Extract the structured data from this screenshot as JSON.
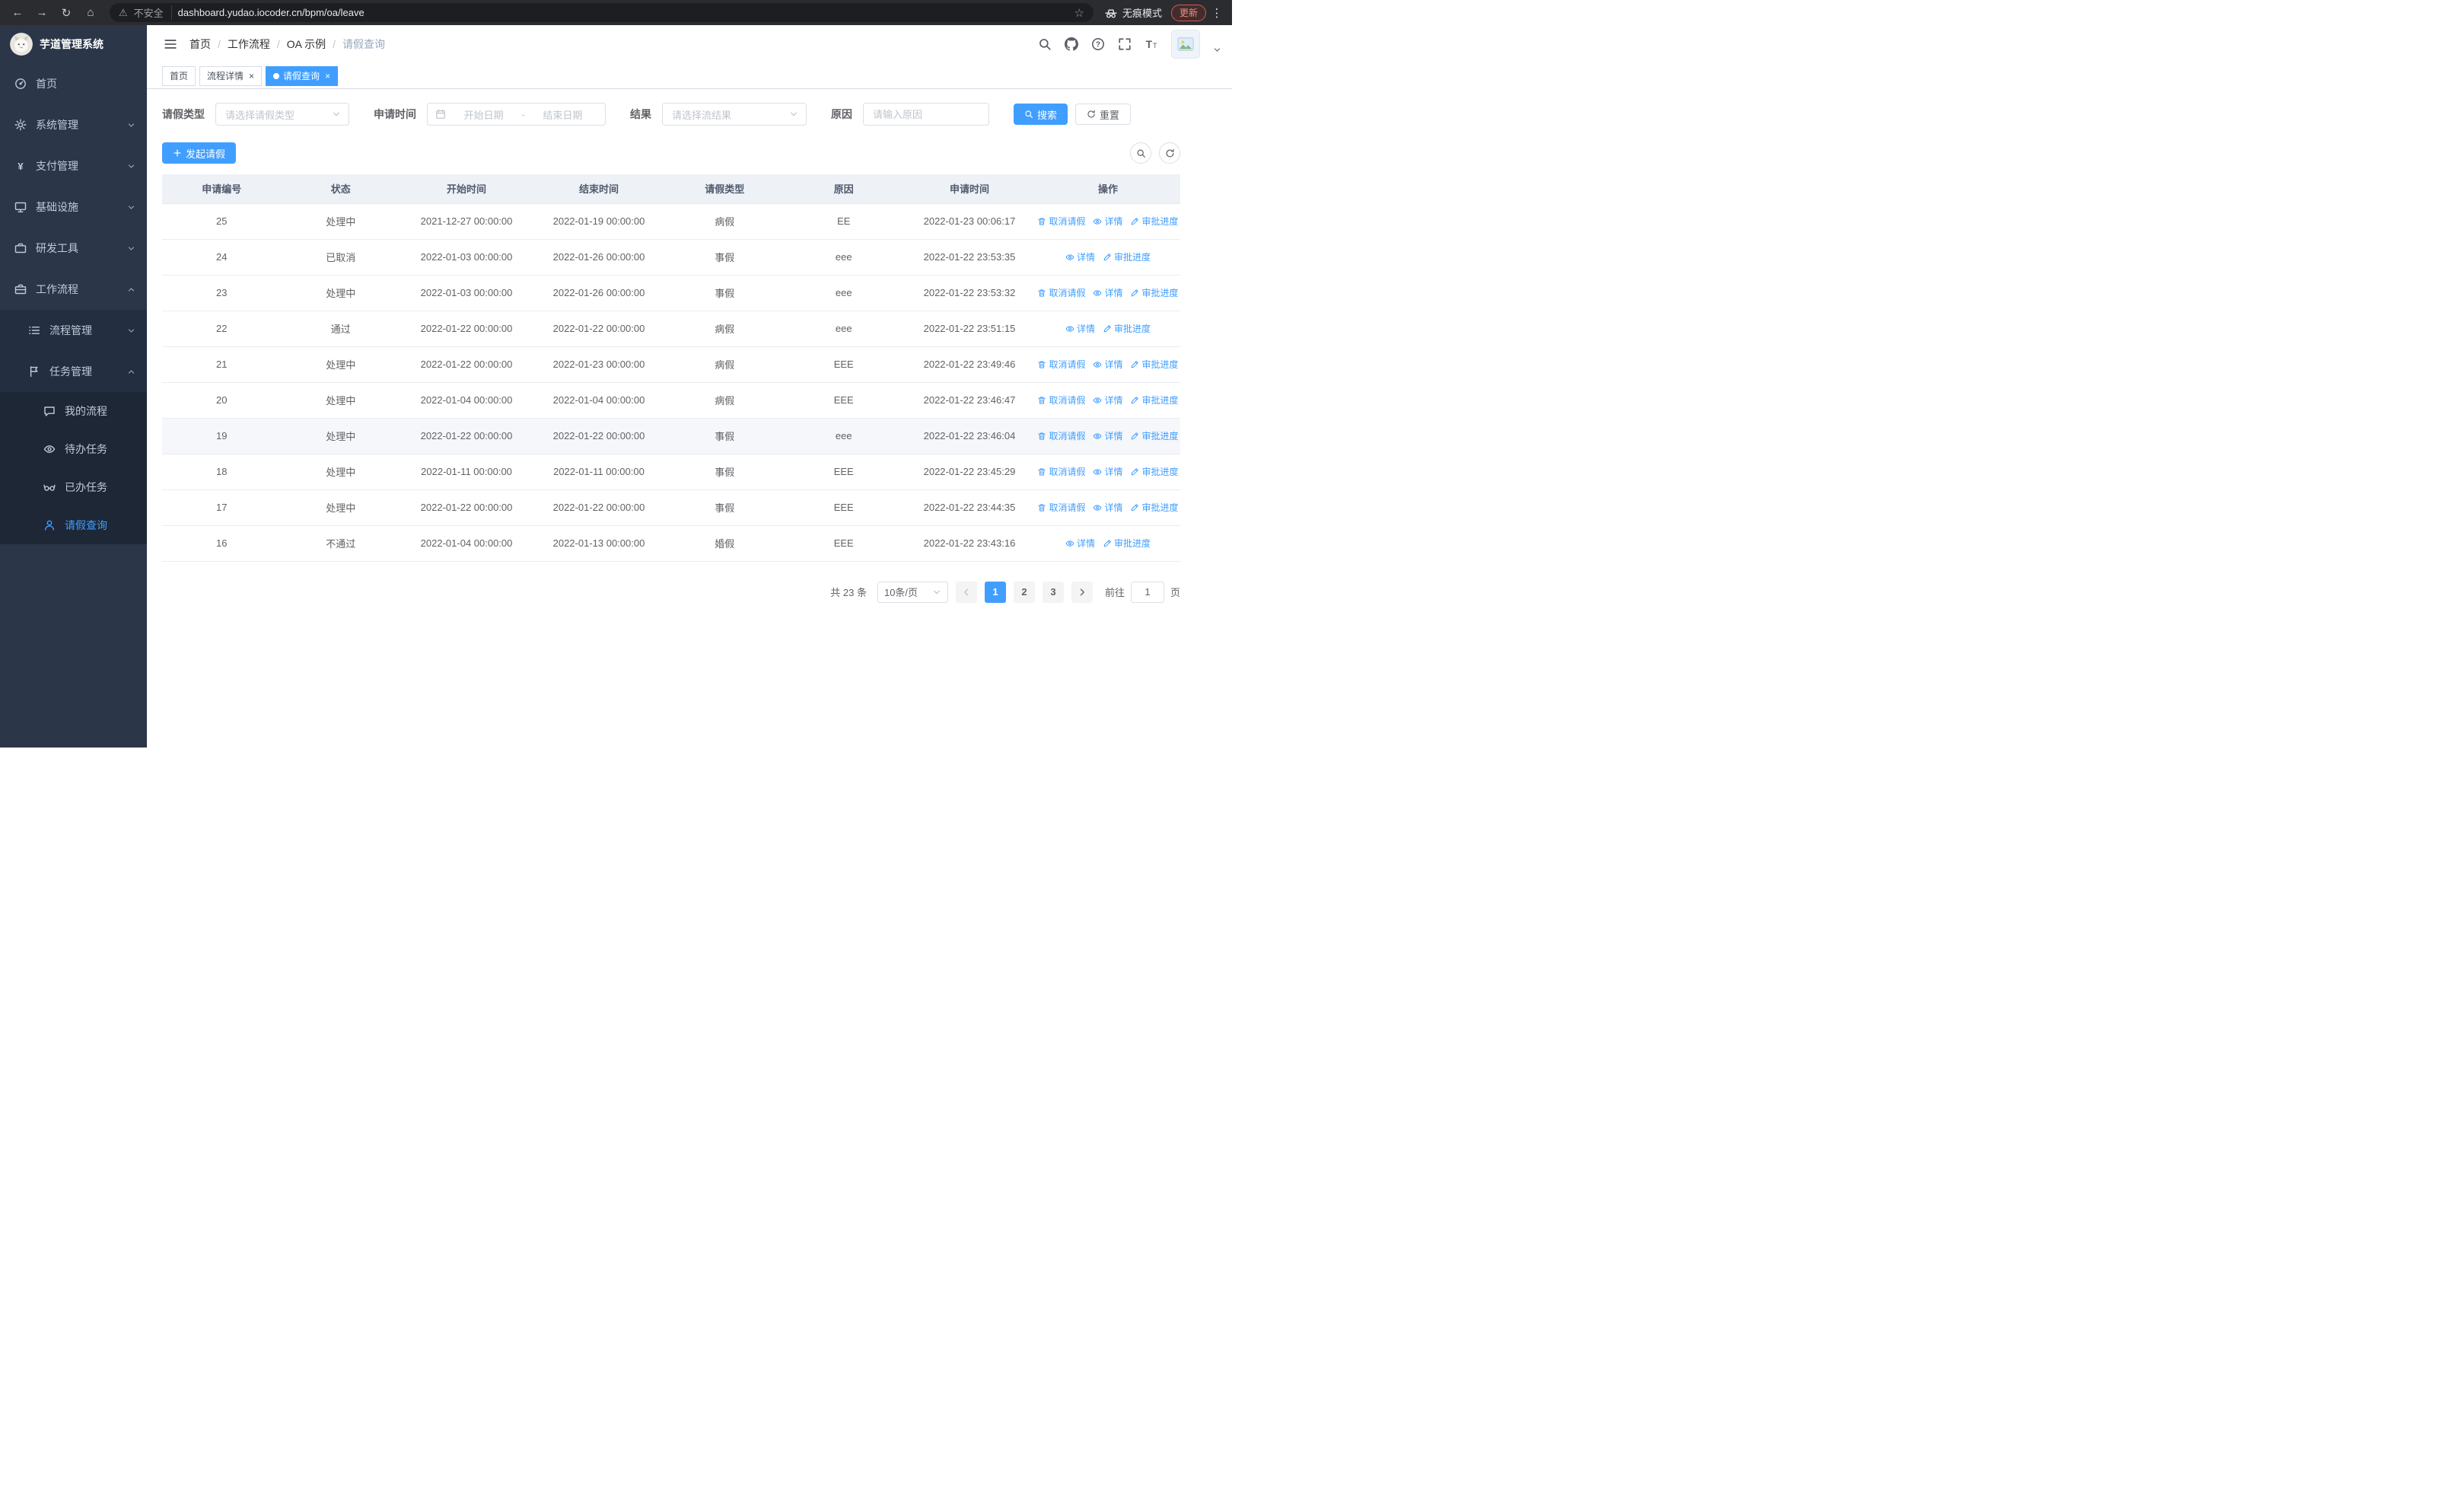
{
  "browser": {
    "security_label": "不安全",
    "url": "dashboard.yudao.iocoder.cn/bpm/oa/leave",
    "incognito_label": "无痕模式",
    "update_label": "更新"
  },
  "colors": {
    "accent": "#409eff",
    "update_chip": "#f08c7d",
    "sidebar_bg": "#2b3648"
  },
  "sidebar": {
    "logo_title": "芋道管理系统",
    "home": "首页",
    "system": "系统管理",
    "payment": "支付管理",
    "infra": "基础设施",
    "devtools": "研发工具",
    "workflow": "工作流程",
    "process_mgmt": "流程管理",
    "task_mgmt": "任务管理",
    "my_process": "我的流程",
    "todo_tasks": "待办任务",
    "done_tasks": "已办任务",
    "leave_query": "请假查询"
  },
  "breadcrumb": [
    "首页",
    "工作流程",
    "OA 示例",
    "请假查询"
  ],
  "tabs": [
    {
      "label": "首页",
      "closable": false,
      "active": false
    },
    {
      "label": "流程详情",
      "closable": true,
      "active": false
    },
    {
      "label": "请假查询",
      "closable": true,
      "active": true
    }
  ],
  "filters": {
    "leave_type_label": "请假类型",
    "leave_type_placeholder": "请选择请假类型",
    "apply_time_label": "申请时间",
    "start_placeholder": "开始日期",
    "separator": "-",
    "end_placeholder": "结束日期",
    "result_label": "结果",
    "result_placeholder": "请选择流结果",
    "reason_label": "原因",
    "reason_placeholder": "请输入原因",
    "search_label": "搜索",
    "reset_label": "重置"
  },
  "toolbar": {
    "create_label": "发起请假"
  },
  "table": {
    "columns": [
      "申请编号",
      "状态",
      "开始时间",
      "结束时间",
      "请假类型",
      "原因",
      "申请时间",
      "操作"
    ],
    "action_labels": {
      "cancel": "取消请假",
      "detail": "详情",
      "progress": "审批进度"
    },
    "rows": [
      {
        "id": "25",
        "status": "处理中",
        "start": "2021-12-27 00:00:00",
        "end": "2022-01-19 00:00:00",
        "type": "病假",
        "reason": "EE",
        "applied": "2022-01-23 00:06:17",
        "actions": [
          "cancel",
          "detail",
          "progress"
        ],
        "highlighted": false
      },
      {
        "id": "24",
        "status": "已取消",
        "start": "2022-01-03 00:00:00",
        "end": "2022-01-26 00:00:00",
        "type": "事假",
        "reason": "eee",
        "applied": "2022-01-22 23:53:35",
        "actions": [
          "detail",
          "progress"
        ],
        "highlighted": false
      },
      {
        "id": "23",
        "status": "处理中",
        "start": "2022-01-03 00:00:00",
        "end": "2022-01-26 00:00:00",
        "type": "事假",
        "reason": "eee",
        "applied": "2022-01-22 23:53:32",
        "actions": [
          "cancel",
          "detail",
          "progress"
        ],
        "highlighted": false
      },
      {
        "id": "22",
        "status": "通过",
        "start": "2022-01-22 00:00:00",
        "end": "2022-01-22 00:00:00",
        "type": "病假",
        "reason": "eee",
        "applied": "2022-01-22 23:51:15",
        "actions": [
          "detail",
          "progress"
        ],
        "highlighted": false
      },
      {
        "id": "21",
        "status": "处理中",
        "start": "2022-01-22 00:00:00",
        "end": "2022-01-23 00:00:00",
        "type": "病假",
        "reason": "EEE",
        "applied": "2022-01-22 23:49:46",
        "actions": [
          "cancel",
          "detail",
          "progress"
        ],
        "highlighted": false
      },
      {
        "id": "20",
        "status": "处理中",
        "start": "2022-01-04 00:00:00",
        "end": "2022-01-04 00:00:00",
        "type": "病假",
        "reason": "EEE",
        "applied": "2022-01-22 23:46:47",
        "actions": [
          "cancel",
          "detail",
          "progress"
        ],
        "highlighted": false
      },
      {
        "id": "19",
        "status": "处理中",
        "start": "2022-01-22 00:00:00",
        "end": "2022-01-22 00:00:00",
        "type": "事假",
        "reason": "eee",
        "applied": "2022-01-22 23:46:04",
        "actions": [
          "cancel",
          "detail",
          "progress"
        ],
        "highlighted": true
      },
      {
        "id": "18",
        "status": "处理中",
        "start": "2022-01-11 00:00:00",
        "end": "2022-01-11 00:00:00",
        "type": "事假",
        "reason": "EEE",
        "applied": "2022-01-22 23:45:29",
        "actions": [
          "cancel",
          "detail",
          "progress"
        ],
        "highlighted": false
      },
      {
        "id": "17",
        "status": "处理中",
        "start": "2022-01-22 00:00:00",
        "end": "2022-01-22 00:00:00",
        "type": "事假",
        "reason": "EEE",
        "applied": "2022-01-22 23:44:35",
        "actions": [
          "cancel",
          "detail",
          "progress"
        ],
        "highlighted": false
      },
      {
        "id": "16",
        "status": "不通过",
        "start": "2022-01-04 00:00:00",
        "end": "2022-01-13 00:00:00",
        "type": "婚假",
        "reason": "EEE",
        "applied": "2022-01-22 23:43:16",
        "actions": [
          "detail",
          "progress"
        ],
        "highlighted": false
      }
    ]
  },
  "pagination": {
    "total_label": "共 23 条",
    "page_size_label": "10条/页",
    "pages": [
      "1",
      "2",
      "3"
    ],
    "active_page": "1",
    "goto_label": "前往",
    "goto_value": "1",
    "unit_label": "页"
  }
}
